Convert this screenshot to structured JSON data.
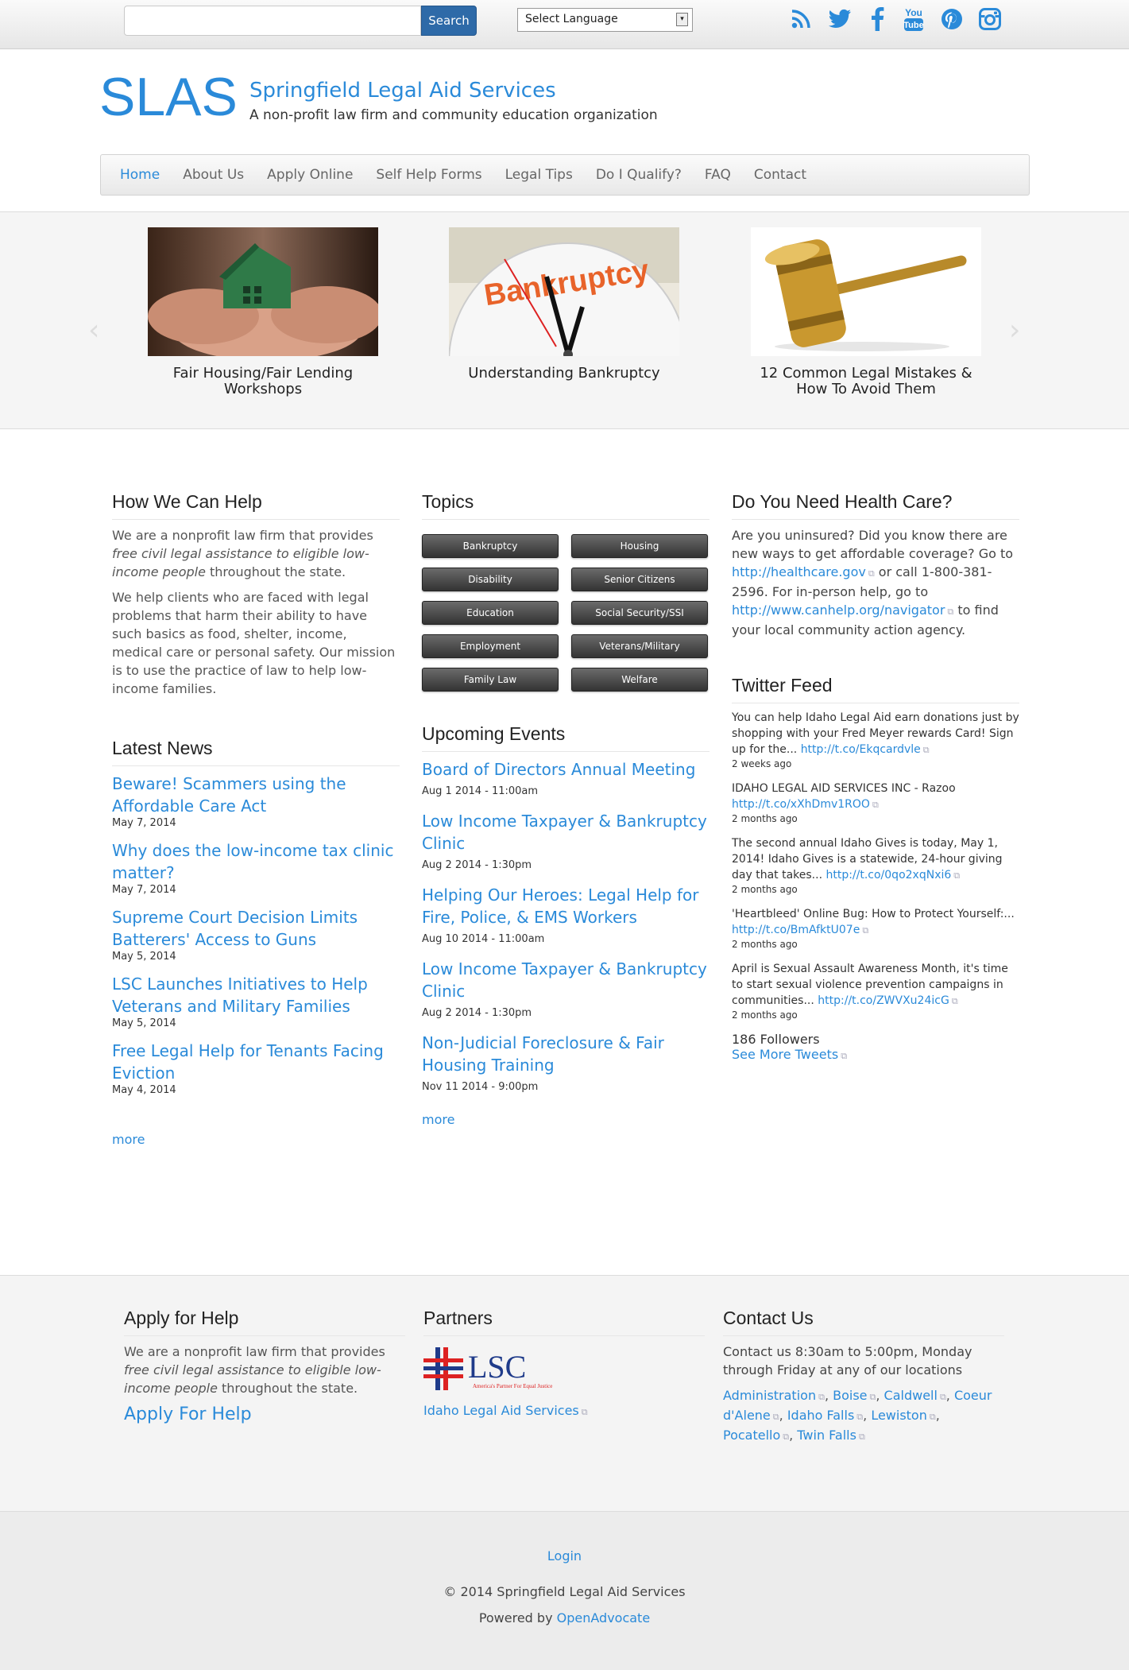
{
  "topbar": {
    "search_placeholder": "",
    "search_button": "Search",
    "language_select": "Select Language",
    "social": [
      "rss-icon",
      "twitter-icon",
      "facebook-icon",
      "youtube-icon",
      "pinterest-icon",
      "instagram-icon"
    ]
  },
  "header": {
    "logo": "SLAS",
    "site_name": "Springfield Legal Aid Services",
    "slogan": "A non-profit law firm and community education organization"
  },
  "nav": [
    "Home",
    "About Us",
    "Apply Online",
    "Self Help Forms",
    "Legal Tips",
    "Do I Qualify?",
    "FAQ",
    "Contact"
  ],
  "carousel": [
    {
      "caption": "Fair Housing/Fair Lending Workshops"
    },
    {
      "caption": "Understanding Bankruptcy",
      "image_text": "Bankruptcy"
    },
    {
      "caption": "12 Common Legal Mistakes & How To Avoid Them"
    }
  ],
  "help": {
    "title": "How We Can Help",
    "p1_a": "We are a nonprofit law firm that provides ",
    "p1_em": "free civil legal assistance to eligible low-income people",
    "p1_b": " throughout the state.",
    "p2": "We help clients who are faced with legal problems that harm their ability to have such basics as food, shelter, income, medical care or personal safety. Our mission is to use the practice of law to help low-income families."
  },
  "news": {
    "title": "Latest News",
    "items": [
      {
        "title": "Beware! Scammers using the Affordable Care Act",
        "date": "May 7, 2014"
      },
      {
        "title": "Why does the low-income tax clinic matter?",
        "date": "May 7, 2014"
      },
      {
        "title": "Supreme Court Decision Limits Batterers' Access to Guns",
        "date": "May 5, 2014"
      },
      {
        "title": "LSC Launches Initiatives to Help Veterans and Military Families",
        "date": "May 5, 2014"
      },
      {
        "title": "Free Legal Help for Tenants Facing Eviction",
        "date": "May 4, 2014"
      }
    ],
    "more": "more"
  },
  "topics": {
    "title": "Topics",
    "items": [
      "Bankruptcy",
      "Housing",
      "Disability",
      "Senior Citizens",
      "Education",
      "Social Security/SSI",
      "Employment",
      "Veterans/Military",
      "Family Law",
      "Welfare"
    ]
  },
  "events": {
    "title": "Upcoming Events",
    "items": [
      {
        "title": "Board of Directors Annual Meeting",
        "date": "Aug 1 2014 - 11:00am"
      },
      {
        "title": "Low Income Taxpayer & Bankruptcy Clinic",
        "date": "Aug 2 2014 - 1:30pm"
      },
      {
        "title": "Helping Our Heroes: Legal Help for Fire, Police, & EMS Workers",
        "date": "Aug 10 2014 - 11:00am"
      },
      {
        "title": "Low Income Taxpayer & Bankruptcy Clinic",
        "date": "Aug 2 2014 - 1:30pm"
      },
      {
        "title": "Non-Judicial Foreclosure & Fair Housing Training",
        "date": "Nov 11 2014 - 9:00pm"
      }
    ],
    "more": "more"
  },
  "health": {
    "title": "Do You Need Health Care?",
    "t1": "Are you uninsured? Did you know there are new ways to get affordable coverage? Go to ",
    "link1": "http://healthcare.gov",
    "t2": " or call 1-800-381-2596. For in-person help, go to ",
    "link2": "http://www.canhelp.org/navigator",
    "t3": " to find your local community action agency."
  },
  "twitter": {
    "title": "Twitter Feed",
    "tweets": [
      {
        "text": "You can help Idaho Legal Aid earn donations just by shopping with your Fred Meyer rewards Card! Sign up for the... ",
        "link": "http://t.co/Ekqcardvle",
        "ago": "2 weeks ago"
      },
      {
        "text": "IDAHO LEGAL AID SERVICES INC - Razoo ",
        "link": "http://t.co/xXhDmv1ROO",
        "ago": "2 months ago"
      },
      {
        "text": "The second annual Idaho Gives is today, May 1, 2014! Idaho Gives is a statewide, 24-hour giving day that takes... ",
        "link": "http://t.co/0qo2xqNxi6",
        "ago": "2 months ago"
      },
      {
        "text": "'Heartbleed' Online Bug: How to Protect Yourself:... ",
        "link": "http://t.co/BmAfktU07e",
        "ago": "2 months ago"
      },
      {
        "text": "April is Sexual Assault Awareness Month, it's time to start sexual violence prevention campaigns in communities... ",
        "link": "http://t.co/ZWVXu24icG",
        "ago": "2 months ago"
      }
    ],
    "followers": "186 Followers",
    "see_more": "See More Tweets"
  },
  "footer": {
    "apply": {
      "title": "Apply for Help",
      "p_a": "We are a nonprofit law firm that provides ",
      "p_em": "free civil legal assistance to eligible low-income people",
      "p_b": " throughout the state.",
      "link": "Apply For Help"
    },
    "partners": {
      "title": "Partners",
      "logo_text": "LSC",
      "logo_tagline": "America's Partner For Equal Justice",
      "link": "Idaho Legal Aid Services"
    },
    "contact": {
      "title": "Contact Us",
      "text": "Contact us 8:30am to 5:00pm, Monday through Friday at any of our locations",
      "locations": [
        "Administration",
        "Boise",
        "Caldwell",
        "Coeur d'Alene",
        "Idaho Falls",
        "Lewiston",
        "Pocatello",
        "Twin Falls"
      ]
    }
  },
  "bottom": {
    "login": "Login",
    "copyright": "© 2014 Springfield Legal Aid Services",
    "powered_by": "Powered by ",
    "powered_link": "OpenAdvocate"
  },
  "colors": {
    "accent": "#2a8ad9",
    "search_button": "#2e6aa8"
  }
}
